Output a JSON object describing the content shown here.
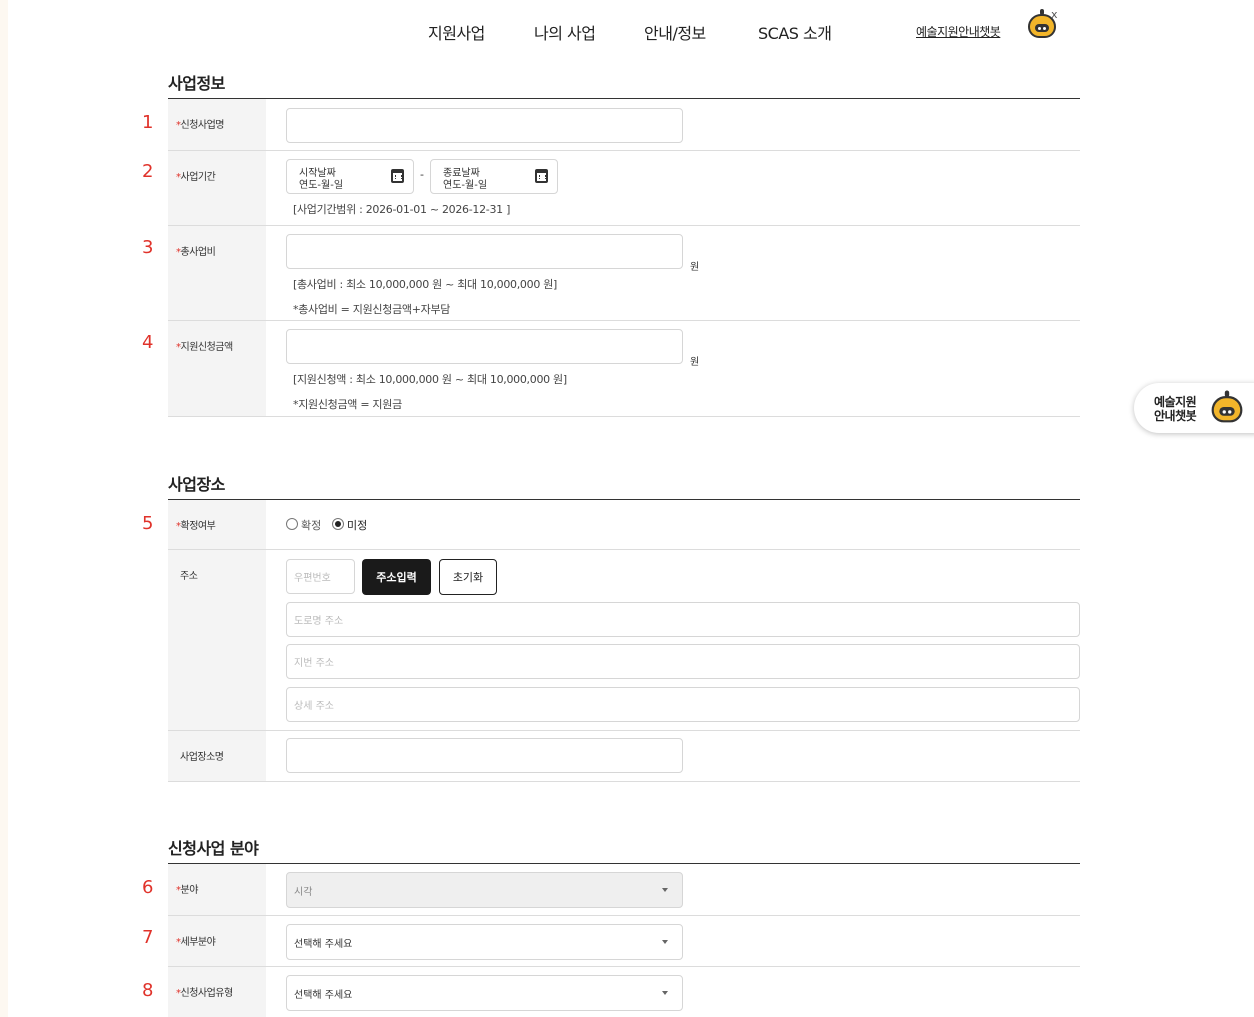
{
  "nav": {
    "items": [
      "지원사업",
      "나의 사업",
      "안내/정보",
      "SCAS 소개"
    ],
    "chatbot_link": "예술지원안내챗봇",
    "close": "x"
  },
  "sections": {
    "business_info": "사업정보",
    "business_place": "사업장소",
    "business_field": "신청사업 분야"
  },
  "row_numbers": [
    "1",
    "2",
    "3",
    "4",
    "5",
    "6",
    "7",
    "8"
  ],
  "required_mark": "*",
  "fields": {
    "project_name": {
      "label": "신청사업명",
      "value": ""
    },
    "period": {
      "label": "사업기간",
      "start_label": "시작날짜",
      "start_value": "연도-월-일",
      "separator": "-",
      "end_label": "종료날짜",
      "end_value": "연도-월-일",
      "hint": "[사업기간범위 : 2026-01-01 ~ 2026-12-31 ]"
    },
    "total_cost": {
      "label": "총사업비",
      "value": "",
      "unit": "원",
      "hint1": "[총사업비 : 최소 10,000,000 원 ~ 최대 10,000,000 원]",
      "hint2": "*총사업비 = 지원신청금액+자부담"
    },
    "support_amount": {
      "label": "지원신청금액",
      "value": "",
      "unit": "원",
      "hint1": "[지원신청액 : 최소 10,000,000 원 ~ 최대 10,000,000 원]",
      "hint2": "*지원신청금액 = 지원금"
    },
    "confirm": {
      "label": "확정여부",
      "options": [
        "확정",
        "미정"
      ],
      "selected": "미정"
    },
    "address": {
      "label": "주소",
      "zip_placeholder": "우편번호",
      "search_button": "주소입력",
      "reset_button": "초기화",
      "road_placeholder": "도로명 주소",
      "jibun_placeholder": "지번 주소",
      "detail_placeholder": "상세 주소"
    },
    "place_name": {
      "label": "사업장소명",
      "value": ""
    },
    "field": {
      "label": "분야",
      "value": "시각"
    },
    "sub_field": {
      "label": "세부분야",
      "value": "선택해 주세요"
    },
    "project_type": {
      "label": "신청사업유형",
      "value": "선택해 주세요"
    }
  },
  "float_chat": {
    "line1": "예술지원",
    "line2": "안내챗봇"
  },
  "colors": {
    "required": "#e0322a",
    "button_dark": "#1a1a1a",
    "robot": "#f2b52a"
  },
  "icons": [
    "robot-icon",
    "calendar-icon",
    "chevron-down-icon"
  ]
}
